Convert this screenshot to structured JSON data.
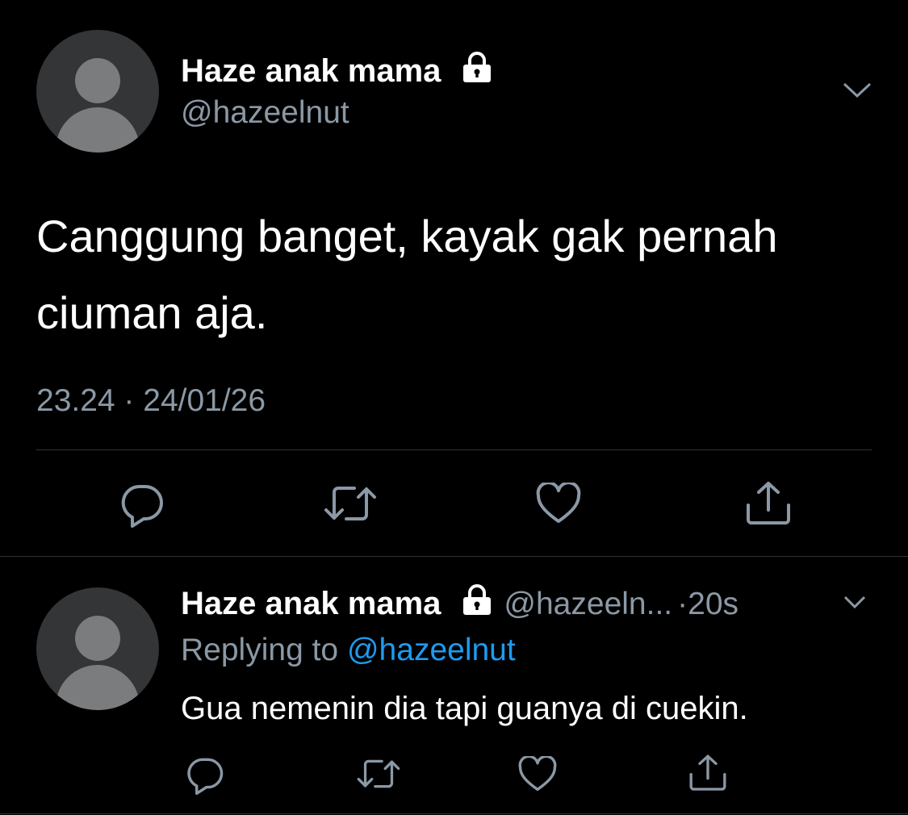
{
  "main_tweet": {
    "author_name": "Haze anak mama",
    "author_handle": "@hazeelnut",
    "protected_icon": "lock-icon",
    "text": "Canggung banget, kayak gak pernah ciuman aja.",
    "timestamp": "23.24 · 24/01/26",
    "actions": [
      "reply-icon",
      "retweet-icon",
      "like-icon",
      "share-icon"
    ]
  },
  "reply_tweet": {
    "author_name": "Haze anak mama",
    "protected_icon": "lock-icon",
    "author_handle": "@hazeeln...",
    "separator": "·",
    "time_ago": "20s",
    "replying_prefix": "Replying to",
    "replying_mention": "@hazeelnut",
    "text": "Gua nemenin dia tapi guanya di cuekin.",
    "actions": [
      "reply-icon",
      "retweet-icon",
      "like-icon",
      "share-icon"
    ]
  },
  "colors": {
    "background": "#000000",
    "text_primary": "#ffffff",
    "text_secondary": "#8b98a5",
    "link": "#1d9bf0",
    "divider": "#2f3336",
    "avatar_bg": "#333536",
    "avatar_fg": "#7a7c7e"
  }
}
